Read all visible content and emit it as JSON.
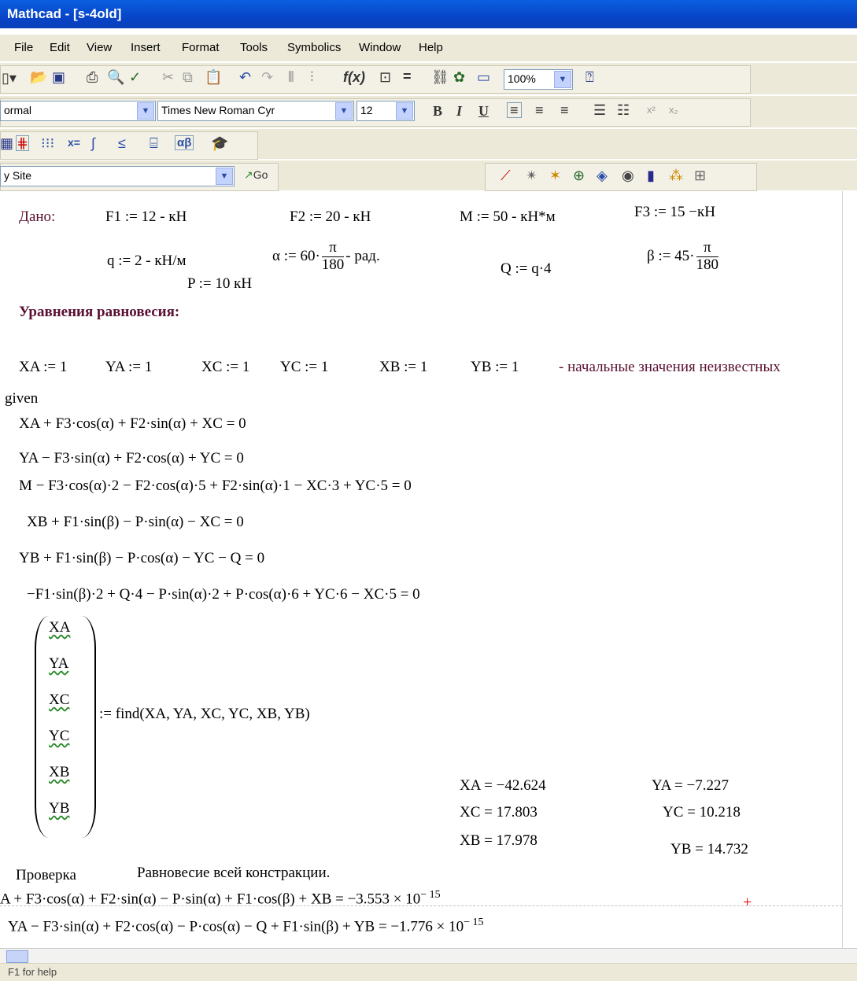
{
  "title": "Mathcad - [s-4old]",
  "menu": [
    "File",
    "Edit",
    "View",
    "Insert",
    "Format",
    "Tools",
    "Symbolics",
    "Window",
    "Help"
  ],
  "toolbar": {
    "zoom": "100%",
    "style": "ormal",
    "font": "Times New Roman Cyr",
    "size": "12",
    "bold": "B",
    "italic": "I",
    "underline": "U",
    "site": "y Site",
    "go": "Go"
  },
  "given": {
    "label": "Дано:",
    "f1": "F1 := 12 - кН",
    "f2": "F2 := 20 - кН",
    "m": "M := 50   - кН*м",
    "f3": "F3 := 15   −кН",
    "q": "q := 2    - кН/м",
    "alpha_a": "α := 60·",
    "alpha_b": "- рад.",
    "Q": "Q := q·4",
    "beta_a": "β := 45·",
    "pi": "π",
    "d180": "180",
    "p": "P := 10     кН"
  },
  "equilibrium_heading": "Уравнения равновесия:",
  "initial": {
    "xa": "XA := 1",
    "ya": "YA := 1",
    "xc": "XC := 1",
    "yc": "YC := 1",
    "xb": "XB := 1",
    "yb": "YB := 1",
    "note": "- начальные значения неизвестных"
  },
  "given_kw": "given",
  "equations": [
    "XA + F3·cos(α) + F2·sin(α) + XC = 0",
    "YA − F3·sin(α) + F2·cos(α) + YC = 0",
    "M − F3·cos(α)·2 − F2·cos(α)·5 + F2·sin(α)·1 − XC·3 + YC·5 = 0",
    "XB + F1·sin(β) − P·sin(α) − XC = 0",
    "YB + F1·sin(β) − P·cos(α) − YC − Q = 0",
    "−F1·sin(β)·2 + Q·4 − P·sin(α)·2 + P·cos(α)·6 + YC·6 − XC·5 = 0"
  ],
  "vector": [
    "XA",
    "YA",
    "XC",
    "YC",
    "XB",
    "YB"
  ],
  "find": ":= find(XA, YA, XC, YC, XB, YB)",
  "results": {
    "xa": "XA = −42.624",
    "ya": "YA = −7.227",
    "xc": "XC = 17.803",
    "yc": "YC = 10.218",
    "xb": "XB = 17.978",
    "yb": "YB = 14.732"
  },
  "check": {
    "label": "Проверка",
    "subtitle": "Равновесие всей констракции.",
    "eq1": "A + F3·cos(α) + F2·sin(α) − P·sin(α) + F1·cos(β) + XB = −3.553 × 10",
    "exp1": "− 15",
    "eq2": "YA − F3·sin(α) + F2·cos(α) − P·cos(α) − Q + F1·sin(β) + YB = −1.776 × 10",
    "exp2": "− 15",
    "cursor": "+"
  },
  "status": "F1 for help"
}
